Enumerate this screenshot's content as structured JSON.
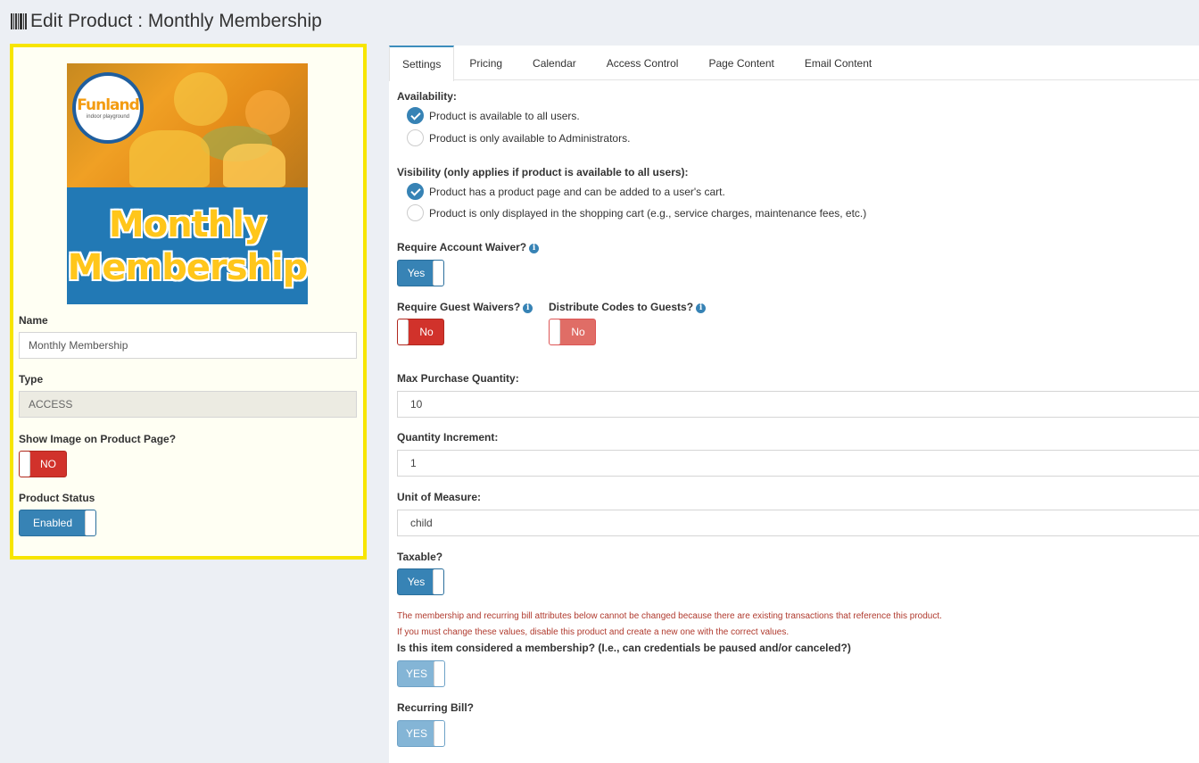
{
  "header": {
    "title": "Edit Product : Monthly Membership",
    "icon": "barcode-icon"
  },
  "product": {
    "image_alt": "Monthly Membership",
    "image_logo_text": "Funland",
    "image_logo_sub": "indoor playground",
    "image_line1": "Monthly",
    "image_line2": "Membership",
    "name_label": "Name",
    "name_value": "Monthly Membership",
    "type_label": "Type",
    "type_value": "ACCESS",
    "show_image_label": "Show Image on Product Page?",
    "show_image_toggle": "NO",
    "status_label": "Product Status",
    "status_toggle": "Enabled"
  },
  "tabs": [
    "Settings",
    "Pricing",
    "Calendar",
    "Access Control",
    "Page Content",
    "Email Content"
  ],
  "settings": {
    "availability_label": "Availability:",
    "availability_options": [
      "Product is available to all users.",
      "Product is only available to Administrators."
    ],
    "visibility_label": "Visibility (only applies if product is available to all users):",
    "visibility_options": [
      "Product has a product page and can be added to a user's cart.",
      "Product is only displayed in the shopping cart (e.g., service charges, maintenance fees, etc.)"
    ],
    "account_waiver_label": "Require Account Waiver?",
    "account_waiver_toggle": "Yes",
    "guest_waivers_label": "Require Guest Waivers?",
    "guest_waivers_toggle": "No",
    "distribute_codes_label": "Distribute Codes to Guests?",
    "distribute_codes_toggle": "No",
    "max_qty_label": "Max Purchase Quantity:",
    "max_qty_value": "10",
    "qty_increment_label": "Quantity Increment:",
    "qty_increment_value": "1",
    "unit_label": "Unit of Measure:",
    "unit_value": "child",
    "taxable_label": "Taxable?",
    "taxable_toggle": "Yes",
    "warning_line1": "The membership and recurring bill attributes below cannot be changed because there are existing transactions that reference this product.",
    "warning_line2": "If you must change these values, disable this product and create a new one with the correct values.",
    "membership_label": "Is this item considered a membership? (I.e., can credentials be paused and/or canceled?)",
    "membership_toggle": "YES",
    "recurring_label": "Recurring Bill?",
    "recurring_toggle": "YES"
  },
  "colors": {
    "highlight_border": "#f7e500",
    "primary_blue": "#3783b5",
    "danger_red": "#d1322b",
    "warning_text": "#b03a2e"
  }
}
